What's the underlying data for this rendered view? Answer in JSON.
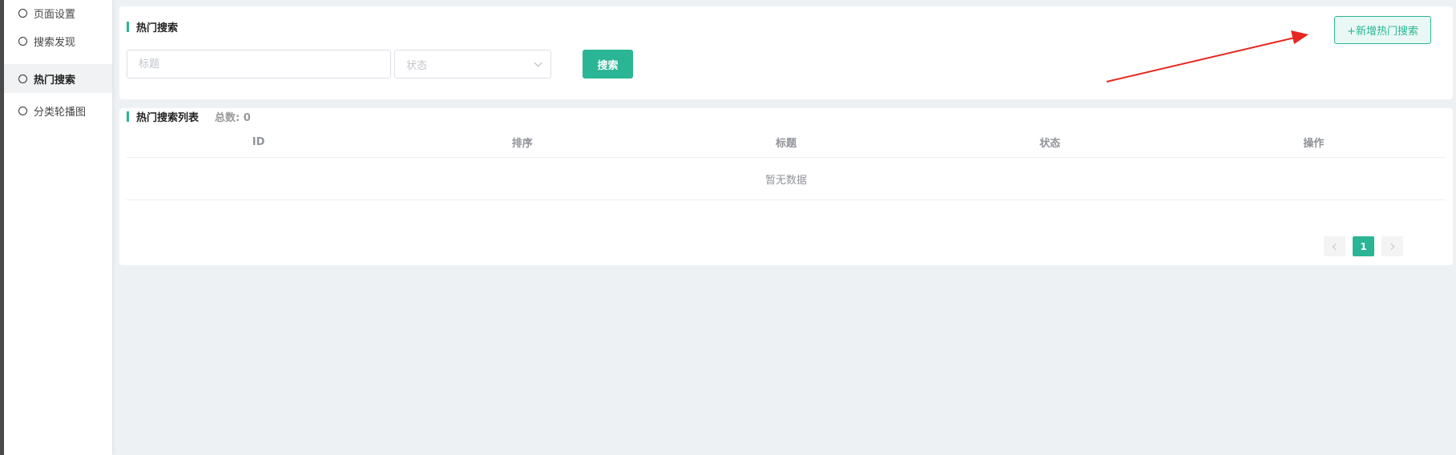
{
  "sidebar": {
    "items": [
      {
        "label": "页面设置",
        "active": false
      },
      {
        "label": "搜索发现",
        "active": false
      },
      {
        "label": "热门搜索",
        "active": true
      },
      {
        "label": "分类轮播图",
        "active": false
      }
    ]
  },
  "filter_panel": {
    "title": "热门搜索",
    "title_input_placeholder": "标题",
    "status_select_placeholder": "状态",
    "search_button": "搜索",
    "add_button": "+新增热门搜索"
  },
  "list_panel": {
    "title": "热门搜索列表",
    "total": "总数: 0",
    "columns": [
      "ID",
      "排序",
      "标题",
      "状态",
      "操作"
    ],
    "empty_text": "暂无数据",
    "pagination": {
      "current_page": "1"
    }
  },
  "colors": {
    "accent": "#2ab594",
    "annotation_arrow": "#e8261f",
    "background": "#eef1f4"
  },
  "annotation": {
    "type": "arrow",
    "icon": "arrow-icon"
  }
}
